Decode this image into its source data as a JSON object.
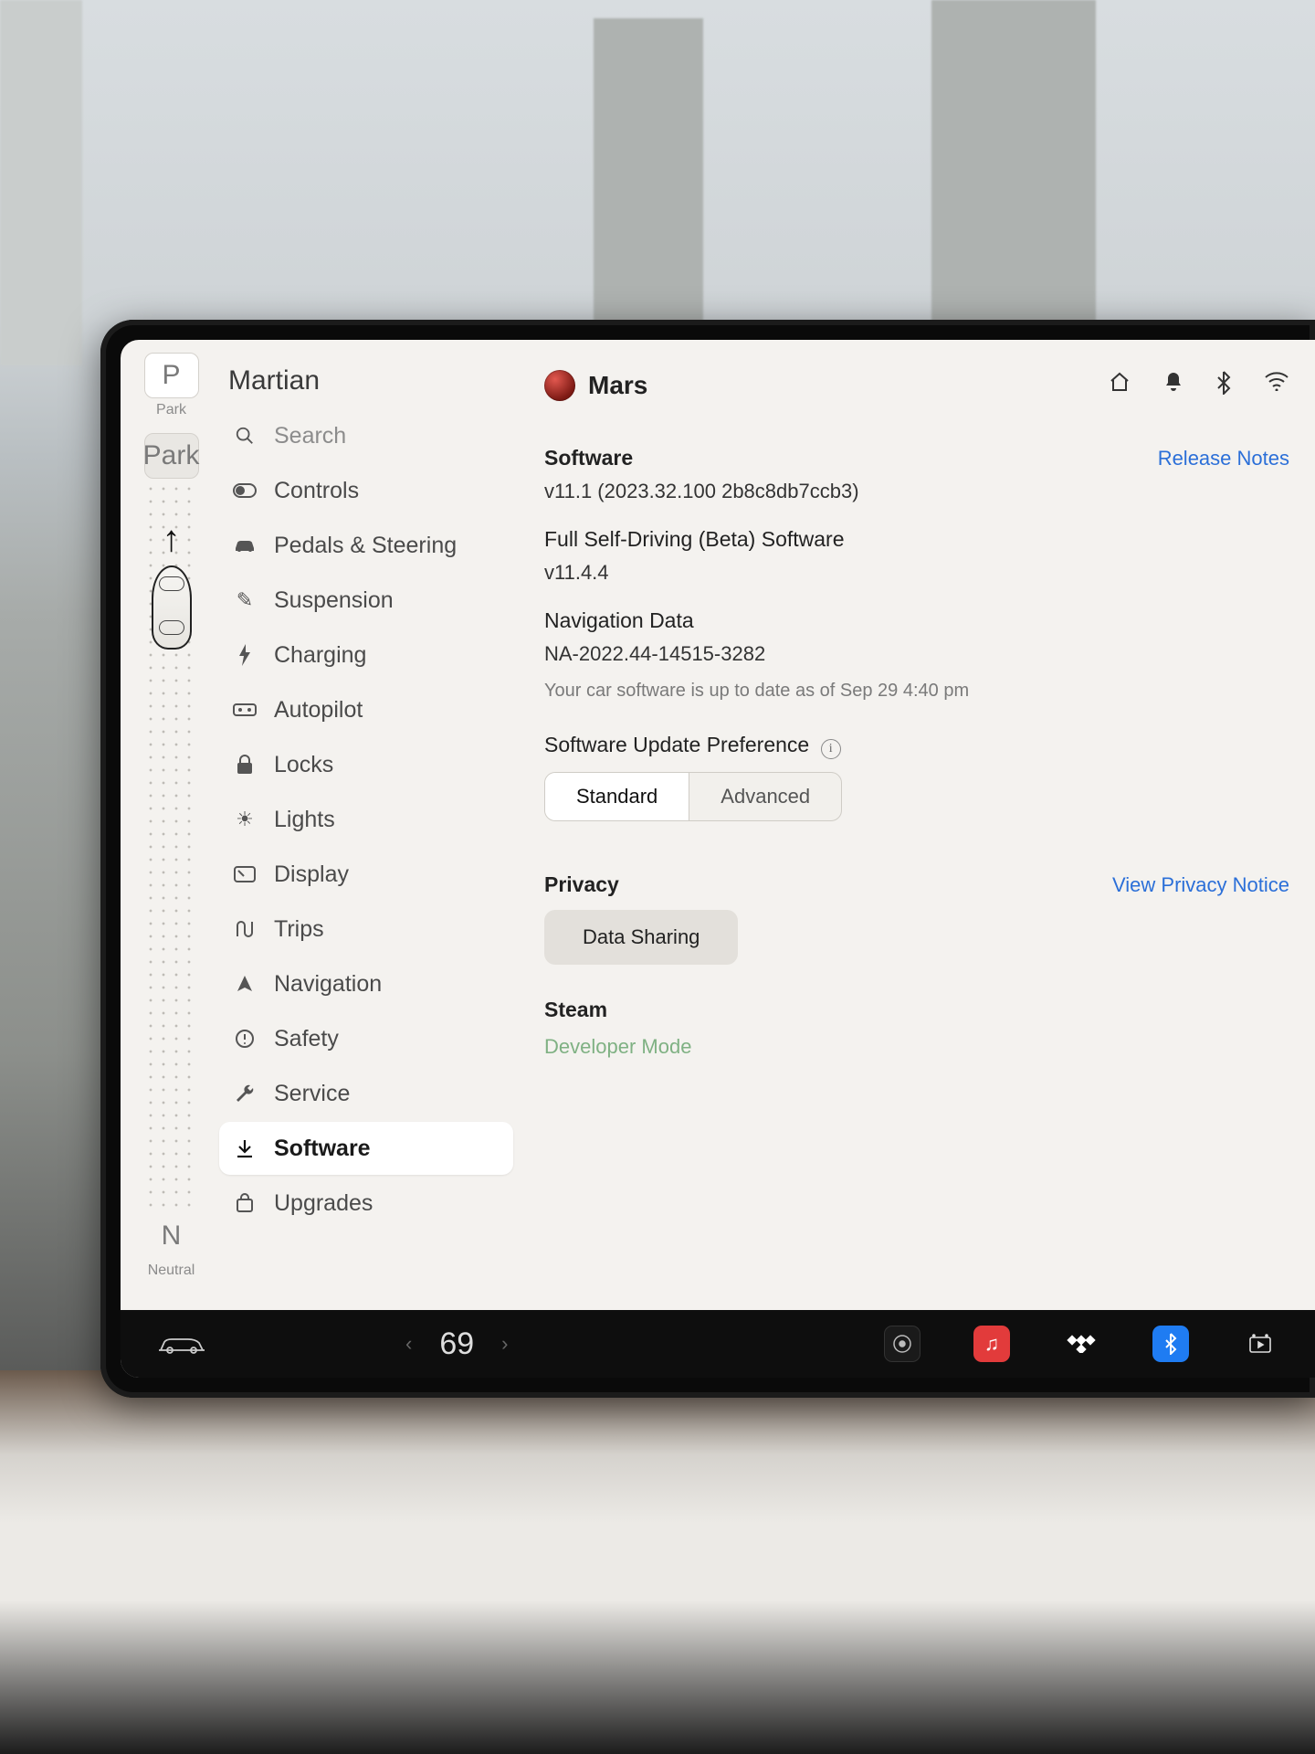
{
  "gear": {
    "p_letter": "P",
    "p_label": "Park",
    "n_letter": "N",
    "n_label": "Neutral"
  },
  "sidebar": {
    "profile": "Martian",
    "items": [
      {
        "icon": "search",
        "label": "Search"
      },
      {
        "icon": "toggle",
        "label": "Controls"
      },
      {
        "icon": "car",
        "label": "Pedals & Steering"
      },
      {
        "icon": "pen",
        "label": "Suspension"
      },
      {
        "icon": "bolt",
        "label": "Charging"
      },
      {
        "icon": "wheel",
        "label": "Autopilot"
      },
      {
        "icon": "lock",
        "label": "Locks"
      },
      {
        "icon": "sun",
        "label": "Lights"
      },
      {
        "icon": "display",
        "label": "Display"
      },
      {
        "icon": "route",
        "label": "Trips"
      },
      {
        "icon": "nav",
        "label": "Navigation"
      },
      {
        "icon": "warn",
        "label": "Safety"
      },
      {
        "icon": "wrench",
        "label": "Service"
      },
      {
        "icon": "download",
        "label": "Software"
      },
      {
        "icon": "bag",
        "label": "Upgrades"
      }
    ]
  },
  "header": {
    "title": "Mars"
  },
  "software": {
    "heading": "Software",
    "release_notes": "Release Notes",
    "version": "v11.1 (2023.32.100 2b8c8db7ccb3)",
    "fsd_heading": "Full Self-Driving (Beta) Software",
    "fsd_version": "v11.4.4",
    "nav_heading": "Navigation Data",
    "nav_version": "NA-2022.44-14515-3282",
    "status": "Your car software is up to date as of Sep 29 4:40 pm",
    "pref_heading": "Software Update Preference",
    "pref_options": {
      "standard": "Standard",
      "advanced": "Advanced"
    }
  },
  "privacy": {
    "heading": "Privacy",
    "link": "View Privacy Notice",
    "button": "Data Sharing"
  },
  "steam": {
    "heading": "Steam",
    "dev": "Developer Mode"
  },
  "dock": {
    "temperature": "69",
    "music_glyph": "♫"
  }
}
